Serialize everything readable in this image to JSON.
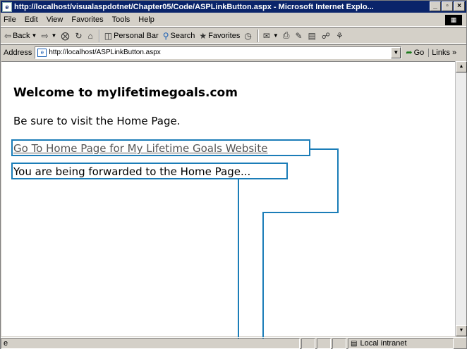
{
  "window": {
    "title": "http://localhost/visualaspdotnet/Chapter05/Code/ASPLinkButton.aspx - Microsoft Internet Explo...",
    "icon": "ie-page-icon",
    "controls": {
      "minimize": "_",
      "maximize": "▫",
      "close": "×"
    }
  },
  "menu": {
    "items": [
      "File",
      "Edit",
      "View",
      "Favorites",
      "Tools",
      "Help"
    ]
  },
  "toolbar": {
    "back": "Back",
    "personal_bar": "Personal Bar",
    "search": "Search",
    "favorites": "Favorites"
  },
  "address": {
    "label": "Address",
    "url": "http://localhost/ASPLinkButton.aspx",
    "go": "Go",
    "links": "Links »"
  },
  "page": {
    "heading": "Welcome to mylifetimegoals.com",
    "visit_text": "Be sure to visit the Home Page.",
    "link_text": "Go To Home Page for My Lifetime Goals Website",
    "forward_text": "You are being forwarded to the Home Page..."
  },
  "status": {
    "zone": "Local intranet"
  },
  "colors": {
    "titlebar": "#0a246a",
    "callout": "#1b7db8",
    "chrome": "#d4d0c8"
  }
}
